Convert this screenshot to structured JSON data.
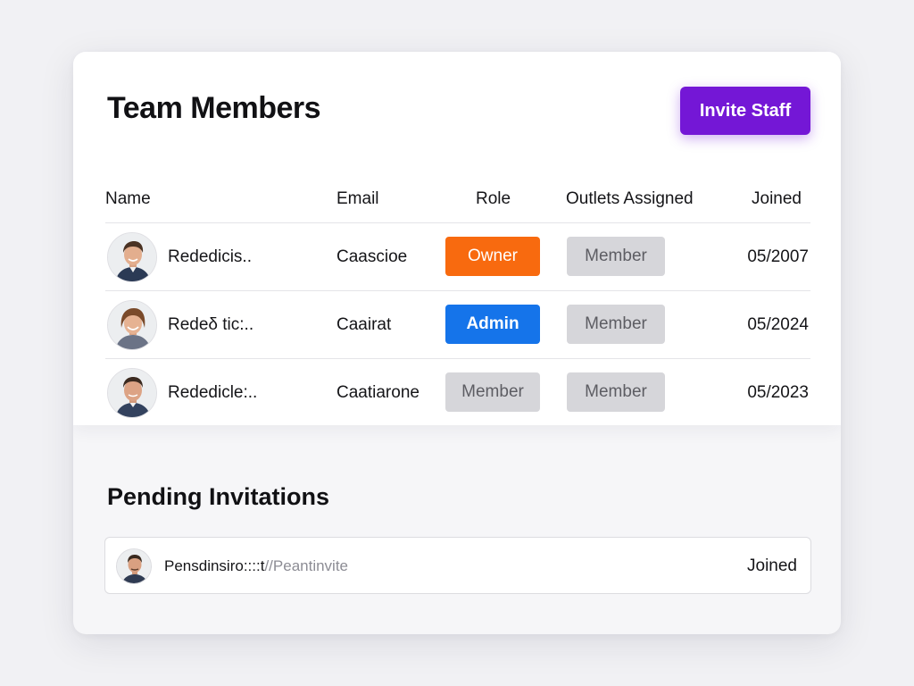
{
  "header": {
    "title": "Team Members",
    "invite_label": "Invite Staff"
  },
  "table": {
    "columns": [
      "Name",
      "Email",
      "Role",
      "Outlets Assigned",
      "Joined"
    ],
    "rows": [
      {
        "name": "Rededicis..",
        "email": "Caascioe",
        "role": "Owner",
        "outlets": "Member",
        "joined": "05/2007"
      },
      {
        "name": "Redeδ tic:..",
        "email": "Caairat",
        "role": "Admin",
        "outlets": "Member",
        "joined": "05/2024"
      },
      {
        "name": "Rededicle:..",
        "email": "Caatiarone",
        "role": "Member",
        "outlets": "Member",
        "joined": "05/2023"
      }
    ]
  },
  "pending": {
    "title": "Pending Invitations",
    "items": [
      {
        "name": "Pensdinsiro::::t",
        "link": "//Peantinvite",
        "status": "Joined"
      }
    ]
  },
  "colors": {
    "invite_button": "#7417d6",
    "owner": "#f86a0f",
    "admin": "#1574ea",
    "member": "#d6d6da"
  },
  "icons": {
    "member_avatar": "person-photo-avatar",
    "pending_avatar": "person-photo-avatar"
  }
}
